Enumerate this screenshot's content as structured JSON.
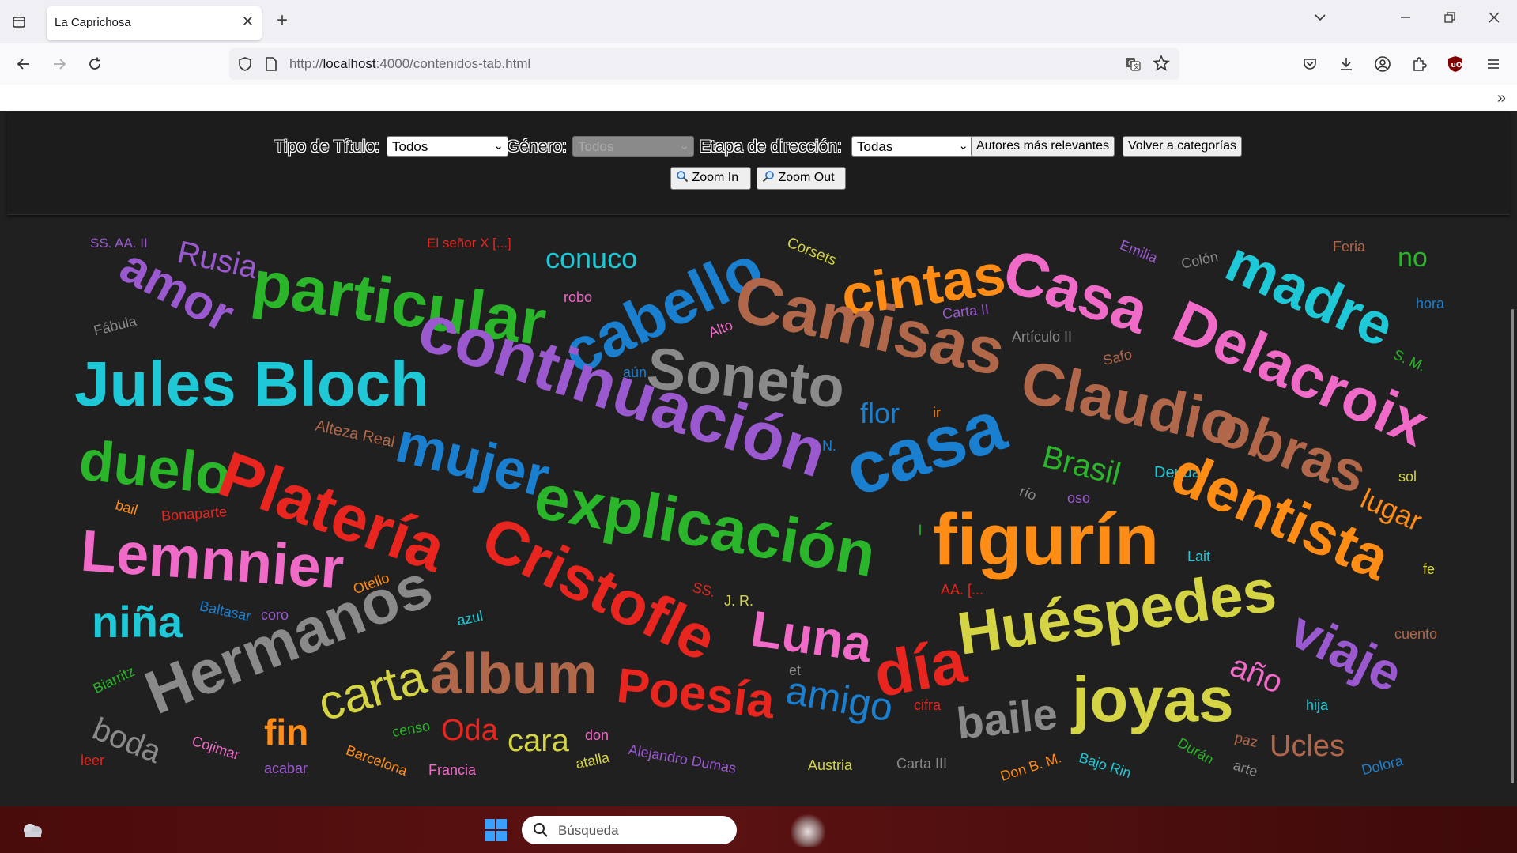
{
  "browser": {
    "tab_title": "La Caprichosa",
    "url_host": "localhost",
    "url_prefix": "http://",
    "url_rest": ":4000/contenidos-tab.html"
  },
  "filters": {
    "tipo_label": "Tipo de Título:",
    "tipo_value": "Todos",
    "genero_label": "Género:",
    "genero_value": "Todos",
    "etapa_label": "Etapa de dirección:",
    "etapa_value": "Todas",
    "autores_button": "Autores más relevantes",
    "volver_button": "Volver a categorías",
    "zoom_in": "Zoom In",
    "zoom_out": "Zoom Out"
  },
  "taskbar": {
    "search_placeholder": "Búsqueda"
  },
  "colors": {
    "purple": "#9b59d0",
    "green": "#2ab52a",
    "cyan": "#1ec8d6",
    "blue": "#1b7fd0",
    "gray": "#8a8a8a",
    "brown": "#b0674a",
    "red": "#e8261f",
    "orange": "#ff8c14",
    "pink": "#f06ac8",
    "yellow": "#d4d444"
  },
  "cloud": [
    {
      "text": "SS. AA. II",
      "color": "purple"
    },
    {
      "text": "Rusia",
      "color": "purple"
    },
    {
      "text": "El señor X [...]",
      "color": "red"
    },
    {
      "text": "conuco",
      "color": "cyan"
    },
    {
      "text": "Corsets",
      "color": "yellow"
    },
    {
      "text": "Emilia",
      "color": "purple"
    },
    {
      "text": "Colón",
      "color": "gray"
    },
    {
      "text": "Feria",
      "color": "brown"
    },
    {
      "text": "no",
      "color": "green"
    },
    {
      "text": "amor",
      "color": "purple"
    },
    {
      "text": "particular",
      "color": "green"
    },
    {
      "text": "robo",
      "color": "pink"
    },
    {
      "text": "cabello",
      "color": "blue"
    },
    {
      "text": "cintas",
      "color": "orange"
    },
    {
      "text": "Casa",
      "color": "pink"
    },
    {
      "text": "madre",
      "color": "cyan"
    },
    {
      "text": "hora",
      "color": "blue"
    },
    {
      "text": "Fábula",
      "color": "gray"
    },
    {
      "text": "Alto",
      "color": "pink"
    },
    {
      "text": "Carta II",
      "color": "purple"
    },
    {
      "text": "Camisas",
      "color": "brown"
    },
    {
      "text": "Delacroix",
      "color": "pink"
    },
    {
      "text": "Artículo II",
      "color": "gray"
    },
    {
      "text": "S. M.",
      "color": "green"
    },
    {
      "text": "Jules Bloch",
      "color": "cyan"
    },
    {
      "text": "continuación",
      "color": "purple"
    },
    {
      "text": "aún",
      "color": "blue"
    },
    {
      "text": "Soneto",
      "color": "gray"
    },
    {
      "text": "Safo",
      "color": "brown"
    },
    {
      "text": "flor",
      "color": "blue"
    },
    {
      "text": "Claudio",
      "color": "brown"
    },
    {
      "text": "ir",
      "color": "orange"
    },
    {
      "text": "Alteza Real",
      "color": "brown"
    },
    {
      "text": "N.",
      "color": "blue"
    },
    {
      "text": "duelo",
      "color": "green"
    },
    {
      "text": "mujer",
      "color": "blue"
    },
    {
      "text": "casa",
      "color": "blue"
    },
    {
      "text": "Brasil",
      "color": "green"
    },
    {
      "text": "obras",
      "color": "brown"
    },
    {
      "text": "Deuda",
      "color": "cyan"
    },
    {
      "text": "sol",
      "color": "yellow"
    },
    {
      "text": "Platería",
      "color": "red"
    },
    {
      "text": "río",
      "color": "gray"
    },
    {
      "text": "oso",
      "color": "purple"
    },
    {
      "text": "bail",
      "color": "orange"
    },
    {
      "text": "Bonaparte",
      "color": "red"
    },
    {
      "text": "explicación",
      "color": "green"
    },
    {
      "text": "dentista",
      "color": "orange"
    },
    {
      "text": "lugar",
      "color": "orange"
    },
    {
      "text": "l",
      "color": "green"
    },
    {
      "text": "figurín",
      "color": "orange"
    },
    {
      "text": "Lait",
      "color": "cyan"
    },
    {
      "text": "Lemnnier",
      "color": "pink"
    },
    {
      "text": "Cristofle",
      "color": "red"
    },
    {
      "text": "fe",
      "color": "yellow"
    },
    {
      "text": "Otello",
      "color": "orange"
    },
    {
      "text": "SS.",
      "color": "red"
    },
    {
      "text": "J. R.",
      "color": "yellow"
    },
    {
      "text": "AA. [...",
      "color": "red"
    },
    {
      "text": "niña",
      "color": "cyan"
    },
    {
      "text": "Baltasar",
      "color": "blue"
    },
    {
      "text": "coro",
      "color": "purple"
    },
    {
      "text": "Hermanos",
      "color": "gray"
    },
    {
      "text": "azul",
      "color": "cyan"
    },
    {
      "text": "Luna",
      "color": "pink"
    },
    {
      "text": "Huéspedes",
      "color": "yellow"
    },
    {
      "text": "cuento",
      "color": "brown"
    },
    {
      "text": "viaje",
      "color": "purple"
    },
    {
      "text": "Biarritz",
      "color": "green"
    },
    {
      "text": "año",
      "color": "pink"
    },
    {
      "text": "et",
      "color": "gray"
    },
    {
      "text": "álbum",
      "color": "brown"
    },
    {
      "text": "día",
      "color": "red"
    },
    {
      "text": "carta",
      "color": "yellow"
    },
    {
      "text": "Poesía",
      "color": "red"
    },
    {
      "text": "amigo",
      "color": "blue"
    },
    {
      "text": "cifra",
      "color": "red"
    },
    {
      "text": "joyas",
      "color": "yellow"
    },
    {
      "text": "hija",
      "color": "cyan"
    },
    {
      "text": "fin",
      "color": "orange"
    },
    {
      "text": "baile",
      "color": "gray"
    },
    {
      "text": "boda",
      "color": "gray"
    },
    {
      "text": "censo",
      "color": "green"
    },
    {
      "text": "Oda",
      "color": "red"
    },
    {
      "text": "cara",
      "color": "yellow"
    },
    {
      "text": "don",
      "color": "pink"
    },
    {
      "text": "paz",
      "color": "brown"
    },
    {
      "text": "Ucles",
      "color": "brown"
    },
    {
      "text": "Cojimar",
      "color": "pink"
    },
    {
      "text": "Durán",
      "color": "green"
    },
    {
      "text": "leer",
      "color": "red"
    },
    {
      "text": "Barcelona",
      "color": "orange"
    },
    {
      "text": "atalla",
      "color": "yellow"
    },
    {
      "text": "Alejandro Dumas",
      "color": "purple"
    },
    {
      "text": "Austria",
      "color": "yellow"
    },
    {
      "text": "Carta III",
      "color": "gray"
    },
    {
      "text": "Don B. M.",
      "color": "orange"
    },
    {
      "text": "Bajo Rin",
      "color": "cyan"
    },
    {
      "text": "arte",
      "color": "gray"
    },
    {
      "text": "Dolora",
      "color": "blue"
    },
    {
      "text": "acabar",
      "color": "purple"
    },
    {
      "text": "Francia",
      "color": "pink"
    }
  ]
}
